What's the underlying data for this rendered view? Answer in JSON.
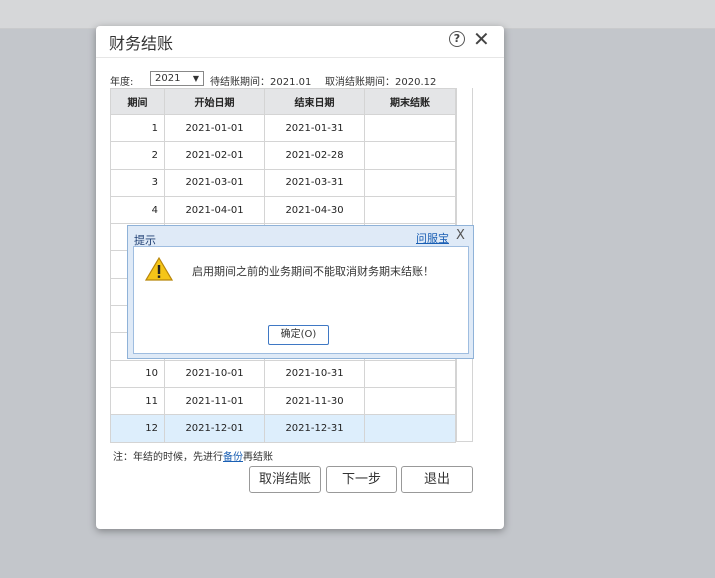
{
  "dialog": {
    "title": "财务结账",
    "year_label": "年度:",
    "year_value": "2021",
    "pending_period": "待结账期间：2021.01",
    "cancel_period": "取消结账期间：2020.12",
    "table": {
      "headers": [
        "期间",
        "开始日期",
        "结束日期",
        "期末结账"
      ],
      "rows": [
        [
          "1",
          "2021-01-01",
          "2021-01-31",
          ""
        ],
        [
          "2",
          "2021-02-01",
          "2021-02-28",
          ""
        ],
        [
          "3",
          "2021-03-01",
          "2021-03-31",
          ""
        ],
        [
          "4",
          "2021-04-01",
          "2021-04-30",
          ""
        ],
        [
          "",
          "",
          "",
          ""
        ],
        [
          "",
          "",
          "",
          ""
        ],
        [
          "",
          "",
          "",
          ""
        ],
        [
          "",
          "",
          "",
          ""
        ],
        [
          "",
          "",
          "",
          ""
        ],
        [
          "10",
          "2021-10-01",
          "2021-10-31",
          ""
        ],
        [
          "11",
          "2021-11-01",
          "2021-11-30",
          ""
        ],
        [
          "12",
          "2021-12-01",
          "2021-12-31",
          ""
        ]
      ]
    },
    "note_prefix": "注：年结的时候，先进行",
    "note_link": "备份",
    "note_suffix": "再结账",
    "buttons": {
      "cancel_close": "取消结账",
      "next_step": "下一步",
      "exit": "退出"
    }
  },
  "message": {
    "title": "提示",
    "help_link": "问服宝",
    "close": "X",
    "text": "启用期间之前的业务期间不能取消财务期末结账！",
    "ok_label": "确定(O)"
  },
  "colors": {
    "selected_row": "#ddeefc",
    "link": "#1a5fb4"
  }
}
